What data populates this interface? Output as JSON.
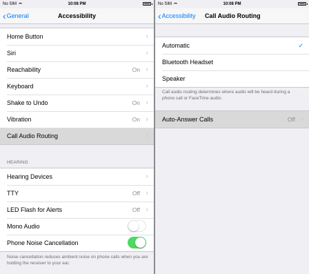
{
  "status": {
    "carrier": "No SIM",
    "time": "10:08 PM"
  },
  "left": {
    "back_label": "General",
    "title": "Accessibility",
    "group1": [
      {
        "label": "Home Button",
        "value": ""
      },
      {
        "label": "Siri",
        "value": ""
      },
      {
        "label": "Reachability",
        "value": "On"
      },
      {
        "label": "Keyboard",
        "value": ""
      },
      {
        "label": "Shake to Undo",
        "value": "On"
      },
      {
        "label": "Vibration",
        "value": "On"
      },
      {
        "label": "Call Audio Routing",
        "value": ""
      }
    ],
    "hearing_header": "HEARING",
    "group2": [
      {
        "label": "Hearing Devices",
        "value": ""
      },
      {
        "label": "TTY",
        "value": "Off"
      },
      {
        "label": "LED Flash for Alerts",
        "value": "Off"
      },
      {
        "label": "Mono Audio",
        "toggle": false
      },
      {
        "label": "Phone Noise Cancellation",
        "toggle": true
      }
    ],
    "footer": "Noise cancellation reduces ambient noise on phone calls when you are holding the receiver to your ear."
  },
  "right": {
    "back_label": "Accessibility",
    "title": "Call Audio Routing",
    "options": [
      {
        "label": "Automatic",
        "checked": true
      },
      {
        "label": "Bluetooth Headset",
        "checked": false
      },
      {
        "label": "Speaker",
        "checked": false
      }
    ],
    "footer": "Call audio routing determines where audio will be heard during a phone call or FaceTime audio.",
    "auto_answer": {
      "label": "Auto-Answer Calls",
      "value": "Off"
    }
  },
  "colors": {
    "accent": "#007aff",
    "toggle_on": "#4cd964",
    "selected_row": "#d9d9d9"
  }
}
